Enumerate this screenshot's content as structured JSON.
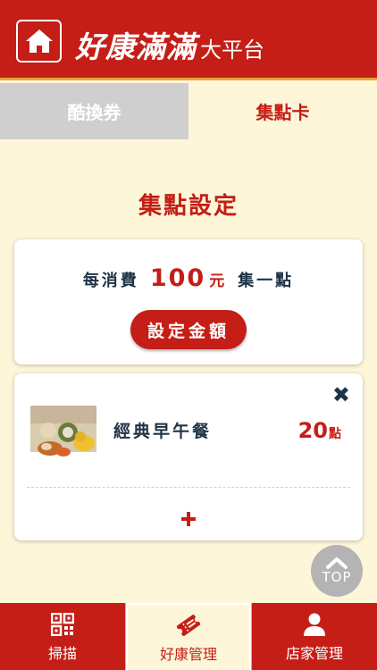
{
  "header": {
    "brand_name": "好康滿滿",
    "brand_sub": "大平台",
    "home_icon": "home-icon"
  },
  "tabs": [
    {
      "label": "酷換券",
      "active": false
    },
    {
      "label": "集點卡",
      "active": true
    }
  ],
  "section_title": "集點設定",
  "rule": {
    "prefix": "每消費",
    "amount": "100",
    "unit": "元",
    "suffix": "集一點"
  },
  "set_amount_button": "設定金額",
  "item": {
    "name": "經典早午餐",
    "points": "20",
    "points_unit": "點",
    "image": "breakfast-photo"
  },
  "top_button": "TOP",
  "bottom_nav": [
    {
      "label": "掃描",
      "icon": "qr-code-icon",
      "active": false
    },
    {
      "label": "好康管理",
      "icon": "ticket-icon",
      "active": true
    },
    {
      "label": "店家管理",
      "icon": "user-icon",
      "active": false
    }
  ],
  "colors": {
    "brand_red": "#c41e17",
    "cream": "#fdf6d9",
    "navy_text": "#1f3346"
  }
}
